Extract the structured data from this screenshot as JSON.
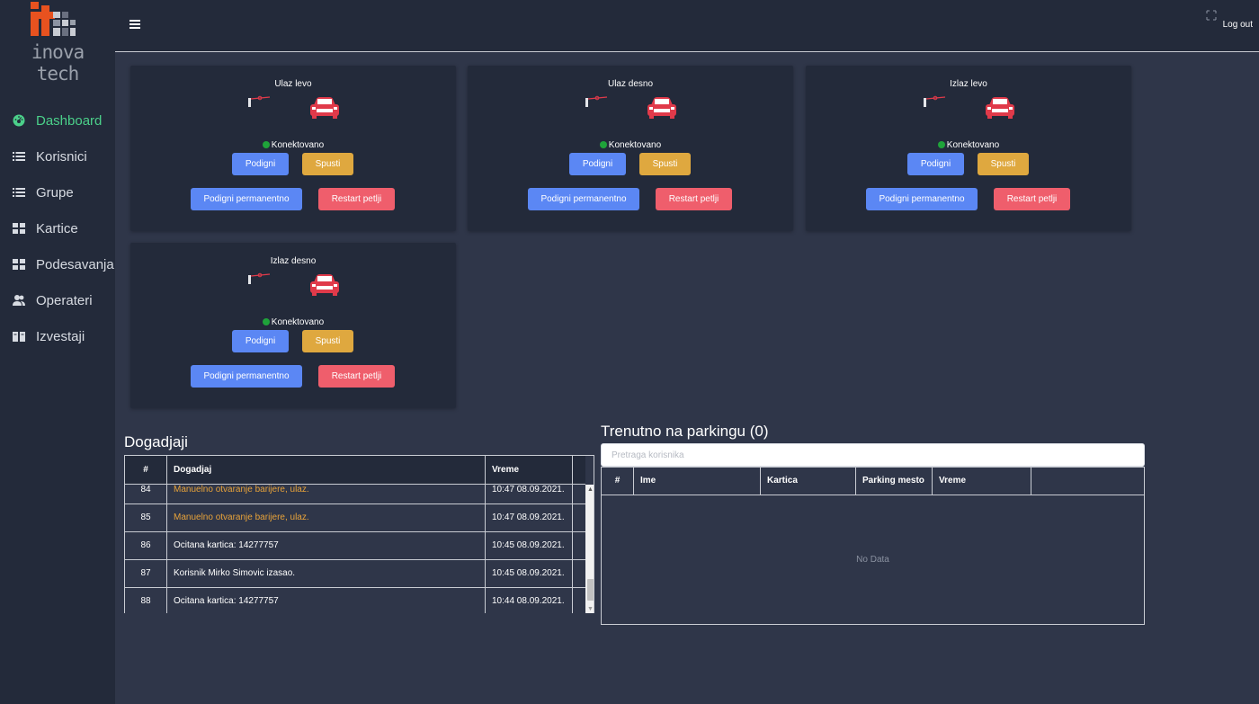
{
  "brand": {
    "name": "inova tech",
    "mark": "it"
  },
  "header": {
    "menu_icon": "hamburger-icon",
    "fullscreen_icon": "fullscreen-icon",
    "logout": "Log out"
  },
  "sidebar": {
    "items": [
      {
        "label": "Dashboard",
        "icon": "dashboard-icon",
        "active": true
      },
      {
        "label": "Korisnici",
        "icon": "list-icon"
      },
      {
        "label": "Grupe",
        "icon": "list-icon"
      },
      {
        "label": "Kartice",
        "icon": "grid-icon"
      },
      {
        "label": "Podesavanja",
        "icon": "grid-icon"
      },
      {
        "label": "Operateri",
        "icon": "users-icon"
      },
      {
        "label": "Izvestaji",
        "icon": "book-icon"
      }
    ]
  },
  "gates": [
    {
      "title": "Ulaz levo",
      "status": "Konektovano",
      "raise": "Podigni",
      "lower": "Spusti",
      "raise_perm": "Podigni permanentno",
      "restart": "Restart petlji"
    },
    {
      "title": "Ulaz desno",
      "status": "Konektovano",
      "raise": "Podigni",
      "lower": "Spusti",
      "raise_perm": "Podigni permanentno",
      "restart": "Restart petlji"
    },
    {
      "title": "Izlaz levo",
      "status": "Konektovano",
      "raise": "Podigni",
      "lower": "Spusti",
      "raise_perm": "Podigni permanentno",
      "restart": "Restart petlji"
    },
    {
      "title": "Izlaz desno",
      "status": "Konektovano",
      "raise": "Podigni",
      "lower": "Spusti",
      "raise_perm": "Podigni permanentno",
      "restart": "Restart petlji"
    }
  ],
  "events": {
    "title": "Dogadjaji",
    "columns": [
      "#",
      "Dogadjaj",
      "Vreme"
    ],
    "rows": [
      {
        "id": "84",
        "text": "Manuelno otvaranje barijere, ulaz.",
        "time": "10:47 08.09.2021.",
        "highlight": true
      },
      {
        "id": "85",
        "text": "Manuelno otvaranje barijere, ulaz.",
        "time": "10:47 08.09.2021.",
        "highlight": true
      },
      {
        "id": "86",
        "text": "Ocitana kartica: 14277757",
        "time": "10:45 08.09.2021.",
        "highlight": false
      },
      {
        "id": "87",
        "text": "Korisnik Mirko Simovic izasao.",
        "time": "10:45 08.09.2021.",
        "highlight": false
      },
      {
        "id": "88",
        "text": "Ocitana kartica: 14277757",
        "time": "10:44 08.09.2021.",
        "highlight": false
      }
    ],
    "highlight_color": "#e8a33a"
  },
  "parking": {
    "title": "Trenutno na parkingu (0)",
    "search_placeholder": "Pretraga korisnika",
    "columns": [
      "#",
      "Ime",
      "Kartica",
      "Parking mesto",
      "Vreme"
    ],
    "empty": "No Data"
  },
  "colors": {
    "active_nav": "#4bd08a",
    "connected": "#1fa33a",
    "primary": "#5b87f4",
    "warning": "#dfa83f",
    "danger": "#ef5e6c"
  }
}
